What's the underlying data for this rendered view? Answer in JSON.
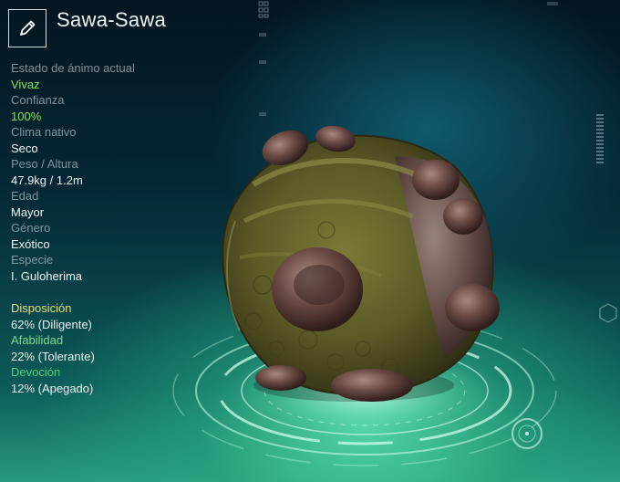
{
  "header": {
    "title": "Sawa-Sawa",
    "edit_icon": "pencil-icon"
  },
  "stats": [
    {
      "label": "Estado de ánimo actual",
      "value": "Vivaz",
      "value_color": "green"
    },
    {
      "label": "Confianza",
      "value": "100%",
      "value_color": "green"
    },
    {
      "label": "Clima nativo",
      "value": "Seco",
      "value_color": "white"
    },
    {
      "label": "Peso / Altura",
      "value": "47.9kg / 1.2m",
      "value_color": "white"
    },
    {
      "label": "Edad",
      "value": "Mayor",
      "value_color": "white"
    },
    {
      "label": "Género",
      "value": "Exótico",
      "value_color": "white"
    },
    {
      "label": "Especie",
      "value": "I. Guloherima",
      "value_color": "white"
    }
  ],
  "traits": [
    {
      "label": "Disposición",
      "value": "62% (Diligente)",
      "label_color": "yellow"
    },
    {
      "label": "Afabilidad",
      "value": "22% (Tolerante)",
      "label_color": "green"
    },
    {
      "label": "Devoción",
      "value": "12% (Apegado)",
      "label_color": "dimgreen"
    }
  ],
  "colors": {
    "accent_green": "#7fe84a",
    "disposition": "#e6e07a",
    "affability": "#7fd88a",
    "devotion": "#4fcf72"
  }
}
